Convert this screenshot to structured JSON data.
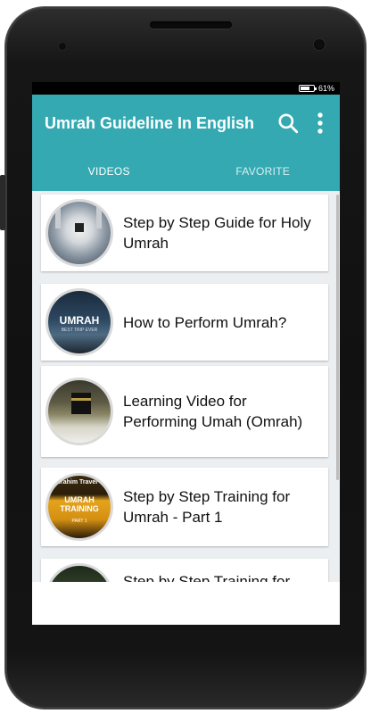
{
  "status": {
    "battery": "61%",
    "battery_level": 0.61
  },
  "app": {
    "title": "Umrah Guideline In English"
  },
  "icons": {
    "search": "search-icon",
    "overflow": "more-vert-icon"
  },
  "tabs": [
    {
      "label": "VIDEOS",
      "active": true
    },
    {
      "label": "FAVORITE",
      "active": false
    }
  ],
  "videos": [
    {
      "title": "Step by Step Guide for Holy Umrah"
    },
    {
      "title": "How to Perform Umrah?",
      "thumb_text": "UMRAH",
      "thumb_sub": "BEST TRIP EVER"
    },
    {
      "title": "Learning Video for Performing Umah (Omrah)"
    },
    {
      "title": "Step by Step Training for Umrah - Part 1",
      "thumb_text": "UMRAH TRAINING",
      "thumb_top": "Ibrahim Travel &",
      "thumb_sub": "PART 1"
    },
    {
      "title": "Step by Step Training for"
    }
  ],
  "colors": {
    "primary": "#35a9b2",
    "background": "#eceff1"
  }
}
